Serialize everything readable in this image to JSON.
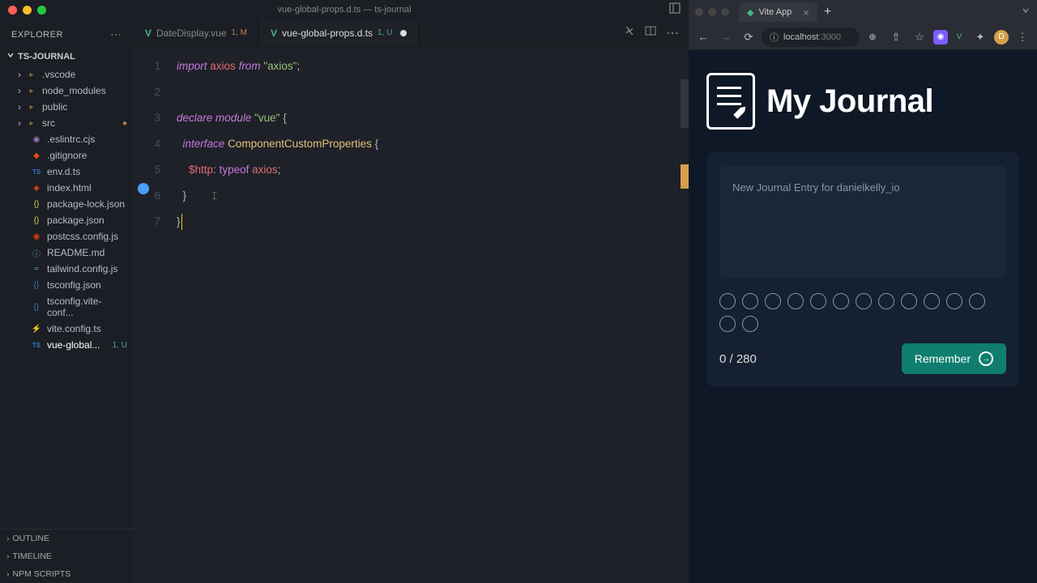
{
  "titlebar": {
    "title": "vue-global-props.d.ts — ts-journal"
  },
  "explorer": {
    "header": "EXPLORER",
    "project": "TS-JOURNAL",
    "items": [
      {
        "name": ".vscode",
        "type": "folder",
        "icon": "📁"
      },
      {
        "name": "node_modules",
        "type": "folder",
        "icon": "📁"
      },
      {
        "name": "public",
        "type": "folder",
        "icon": "📁"
      },
      {
        "name": "src",
        "type": "folder",
        "icon": "📂",
        "expanded": true,
        "modified": true
      },
      {
        "name": ".eslintrc.cjs",
        "type": "file",
        "icon": "⚙"
      },
      {
        "name": ".gitignore",
        "type": "file",
        "icon": "◆"
      },
      {
        "name": "env.d.ts",
        "type": "file",
        "icon": "TS"
      },
      {
        "name": "index.html",
        "type": "file",
        "icon": "◈"
      },
      {
        "name": "package-lock.json",
        "type": "file",
        "icon": "{}"
      },
      {
        "name": "package.json",
        "type": "file",
        "icon": "{}"
      },
      {
        "name": "postcss.config.js",
        "type": "file",
        "icon": "◉"
      },
      {
        "name": "README.md",
        "type": "file",
        "icon": "ⓘ"
      },
      {
        "name": "tailwind.config.js",
        "type": "file",
        "icon": "≈"
      },
      {
        "name": "tsconfig.json",
        "type": "file",
        "icon": "{}"
      },
      {
        "name": "tsconfig.vite-conf...",
        "type": "file",
        "icon": "{}"
      },
      {
        "name": "vite.config.ts",
        "type": "file",
        "icon": "⚡"
      },
      {
        "name": "vue-global...",
        "type": "file",
        "icon": "TS",
        "badge": "1, U"
      }
    ],
    "collapsed": [
      "OUTLINE",
      "TIMELINE",
      "NPM SCRIPTS"
    ]
  },
  "tabs": [
    {
      "name": "DateDisplay.vue",
      "icon": "V",
      "badge": "1, M",
      "badgeType": "m"
    },
    {
      "name": "vue-global-props.d.ts",
      "icon": "V",
      "badge": "1, U",
      "badgeType": "u",
      "active": true,
      "dirty": true
    }
  ],
  "code": {
    "lines": [
      "1",
      "2",
      "3",
      "4",
      "5",
      "6",
      "7"
    ],
    "l1": {
      "import": "import",
      "axios": "axios",
      "from": "from",
      "str": "\"axios\"",
      "semi": ";"
    },
    "l3": {
      "declare": "declare",
      "module": "module",
      "str": "\"vue\"",
      "brace": "{"
    },
    "l4": {
      "interface": "interface",
      "name": "ComponentCustomProperties",
      "brace": "{"
    },
    "l5": {
      "prop": "$http",
      "colon": ":",
      "typeof": "typeof",
      "axios": "axios",
      "semi": ";"
    },
    "l6": {
      "brace": "}"
    },
    "l7": {
      "brace": "}"
    }
  },
  "browser": {
    "tab": {
      "title": "Vite App"
    },
    "url": {
      "host": "localhost",
      "port": ":3000"
    }
  },
  "app": {
    "title": "My Journal",
    "placeholder": "New Journal Entry for danielkelly_io",
    "counter": "0 / 280",
    "button": "Remember",
    "emojiCount": 14
  }
}
